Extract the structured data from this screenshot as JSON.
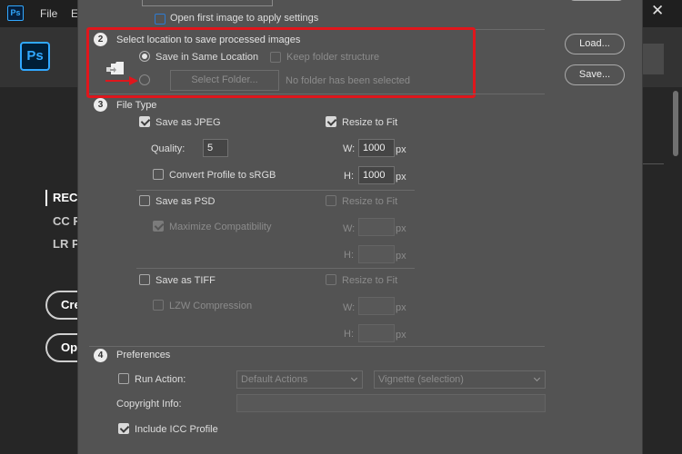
{
  "app": {
    "logo_text": "Ps",
    "menu": [
      "File",
      "E"
    ],
    "close_glyph": "✕",
    "sidebar": [
      "REC",
      "CC F",
      "LR P"
    ],
    "buttons": [
      "Cre",
      "Op"
    ]
  },
  "dialog": {
    "top": {
      "open_first_image_label": "Open first image to apply settings"
    },
    "section2": {
      "number": "2",
      "title": "Select location to save processed images",
      "same_location_label": "Save in Same Location",
      "keep_folder_label": "Keep folder structure",
      "select_folder_label": "Select Folder...",
      "no_folder_text": "No folder has been selected"
    },
    "section3": {
      "number": "3",
      "title": "File Type",
      "jpeg": {
        "save_label": "Save as JPEG",
        "resize_label": "Resize to Fit",
        "quality_label": "Quality:",
        "quality_value": "5",
        "w_label": "W:",
        "w_value": "1000",
        "h_label": "H:",
        "h_value": "1000",
        "unit": "px",
        "convert_label": "Convert Profile to sRGB"
      },
      "psd": {
        "save_label": "Save as PSD",
        "resize_label": "Resize to Fit",
        "maximize_label": "Maximize Compatibility",
        "w_label": "W:",
        "h_label": "H:",
        "unit": "px"
      },
      "tiff": {
        "save_label": "Save as TIFF",
        "resize_label": "Resize to Fit",
        "lzw_label": "LZW Compression",
        "w_label": "W:",
        "h_label": "H:",
        "unit": "px"
      }
    },
    "section4": {
      "number": "4",
      "title": "Preferences",
      "run_action_label": "Run Action:",
      "action_set": "Default Actions",
      "action": "Vignette (selection)",
      "copyright_label": "Copyright Info:",
      "icc_label": "Include ICC Profile"
    },
    "buttons": {
      "load": "Load...",
      "save": "Save..."
    }
  },
  "colors": {
    "highlight": "#e0161c",
    "accent": "#31a8ff",
    "dialog_bg": "#535353"
  }
}
